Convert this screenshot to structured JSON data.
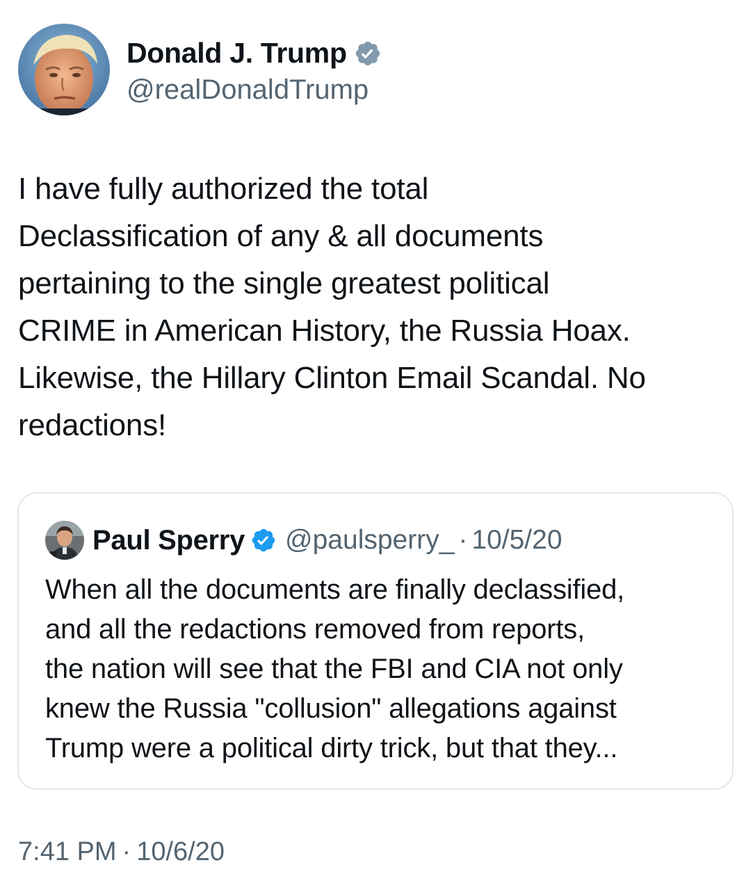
{
  "author": {
    "display_name": "Donald J. Trump",
    "handle": "@realDonaldTrump",
    "verified_badge": "gray-verified-icon",
    "badge_color": "#829aab"
  },
  "tweet": {
    "text": "I have fully authorized the total\nDeclassification of any & all documents\npertaining to the single greatest political\nCRIME in American History, the Russia Hoax.\nLikewise, the Hillary Clinton Email Scandal. No\nredactions!",
    "time": "7:41 PM",
    "separator": "·",
    "date": "10/6/20"
  },
  "quoted_tweet": {
    "display_name": "Paul Sperry",
    "handle": "@paulsperry_",
    "separator": "·",
    "date": "10/5/20",
    "verified_badge": "blue-verified-icon",
    "badge_color": "#1d9bf0",
    "text": "When all the documents are finally declassified,\nand all the redactions removed from reports,\nthe nation will see that the FBI and CIA not only\nknew the Russia \"collusion\" allegations against\nTrump were a political dirty trick, but that they..."
  },
  "colors": {
    "text_primary": "#0f1419",
    "text_secondary": "#536471",
    "border": "#e1e8ed"
  }
}
